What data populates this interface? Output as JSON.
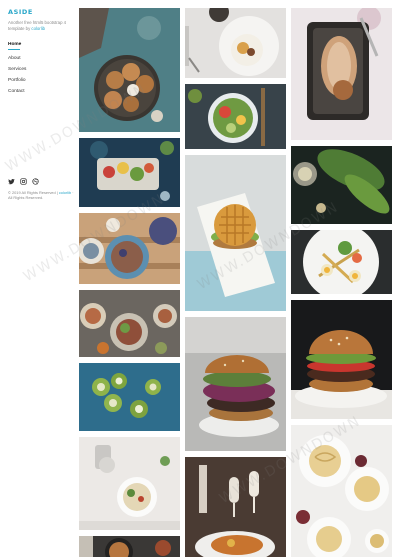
{
  "sidebar": {
    "logo": "ASIDE",
    "tagline_lead": "Another free html5 bootstrap 4 template by ",
    "tagline_author": "colorlib",
    "nav": [
      "Home",
      "About",
      "Services",
      "Portfolio",
      "Contact"
    ],
    "social_icons": [
      "twitter-icon",
      "instagram-icon",
      "dribbble-icon"
    ],
    "copyright_lead": "© 2019 All Rights Reserved | ",
    "copyright_author": "colorlib",
    "copyright_tail": " · All Rights Reserved."
  },
  "watermark": {
    "text": "WWW.DOWNDOWN"
  },
  "gallery": {
    "columns": [
      [
        "cookies-plate",
        "salad-tray",
        "breakfast-bowls",
        "grain-bowls",
        "cucumber-rolls",
        "pasta-table",
        "pan-dish"
      ],
      [
        "bowl-on-plate",
        "salad-bowl",
        "waffle-sandwich",
        "burger-dark",
        "wine-dinner"
      ],
      [
        "stuffed-fish",
        "fresh-greens",
        "shrimp-salad",
        "burger-light",
        "spaghetti-plates"
      ]
    ]
  },
  "colors": {
    "accent": "#2aa7c9"
  }
}
